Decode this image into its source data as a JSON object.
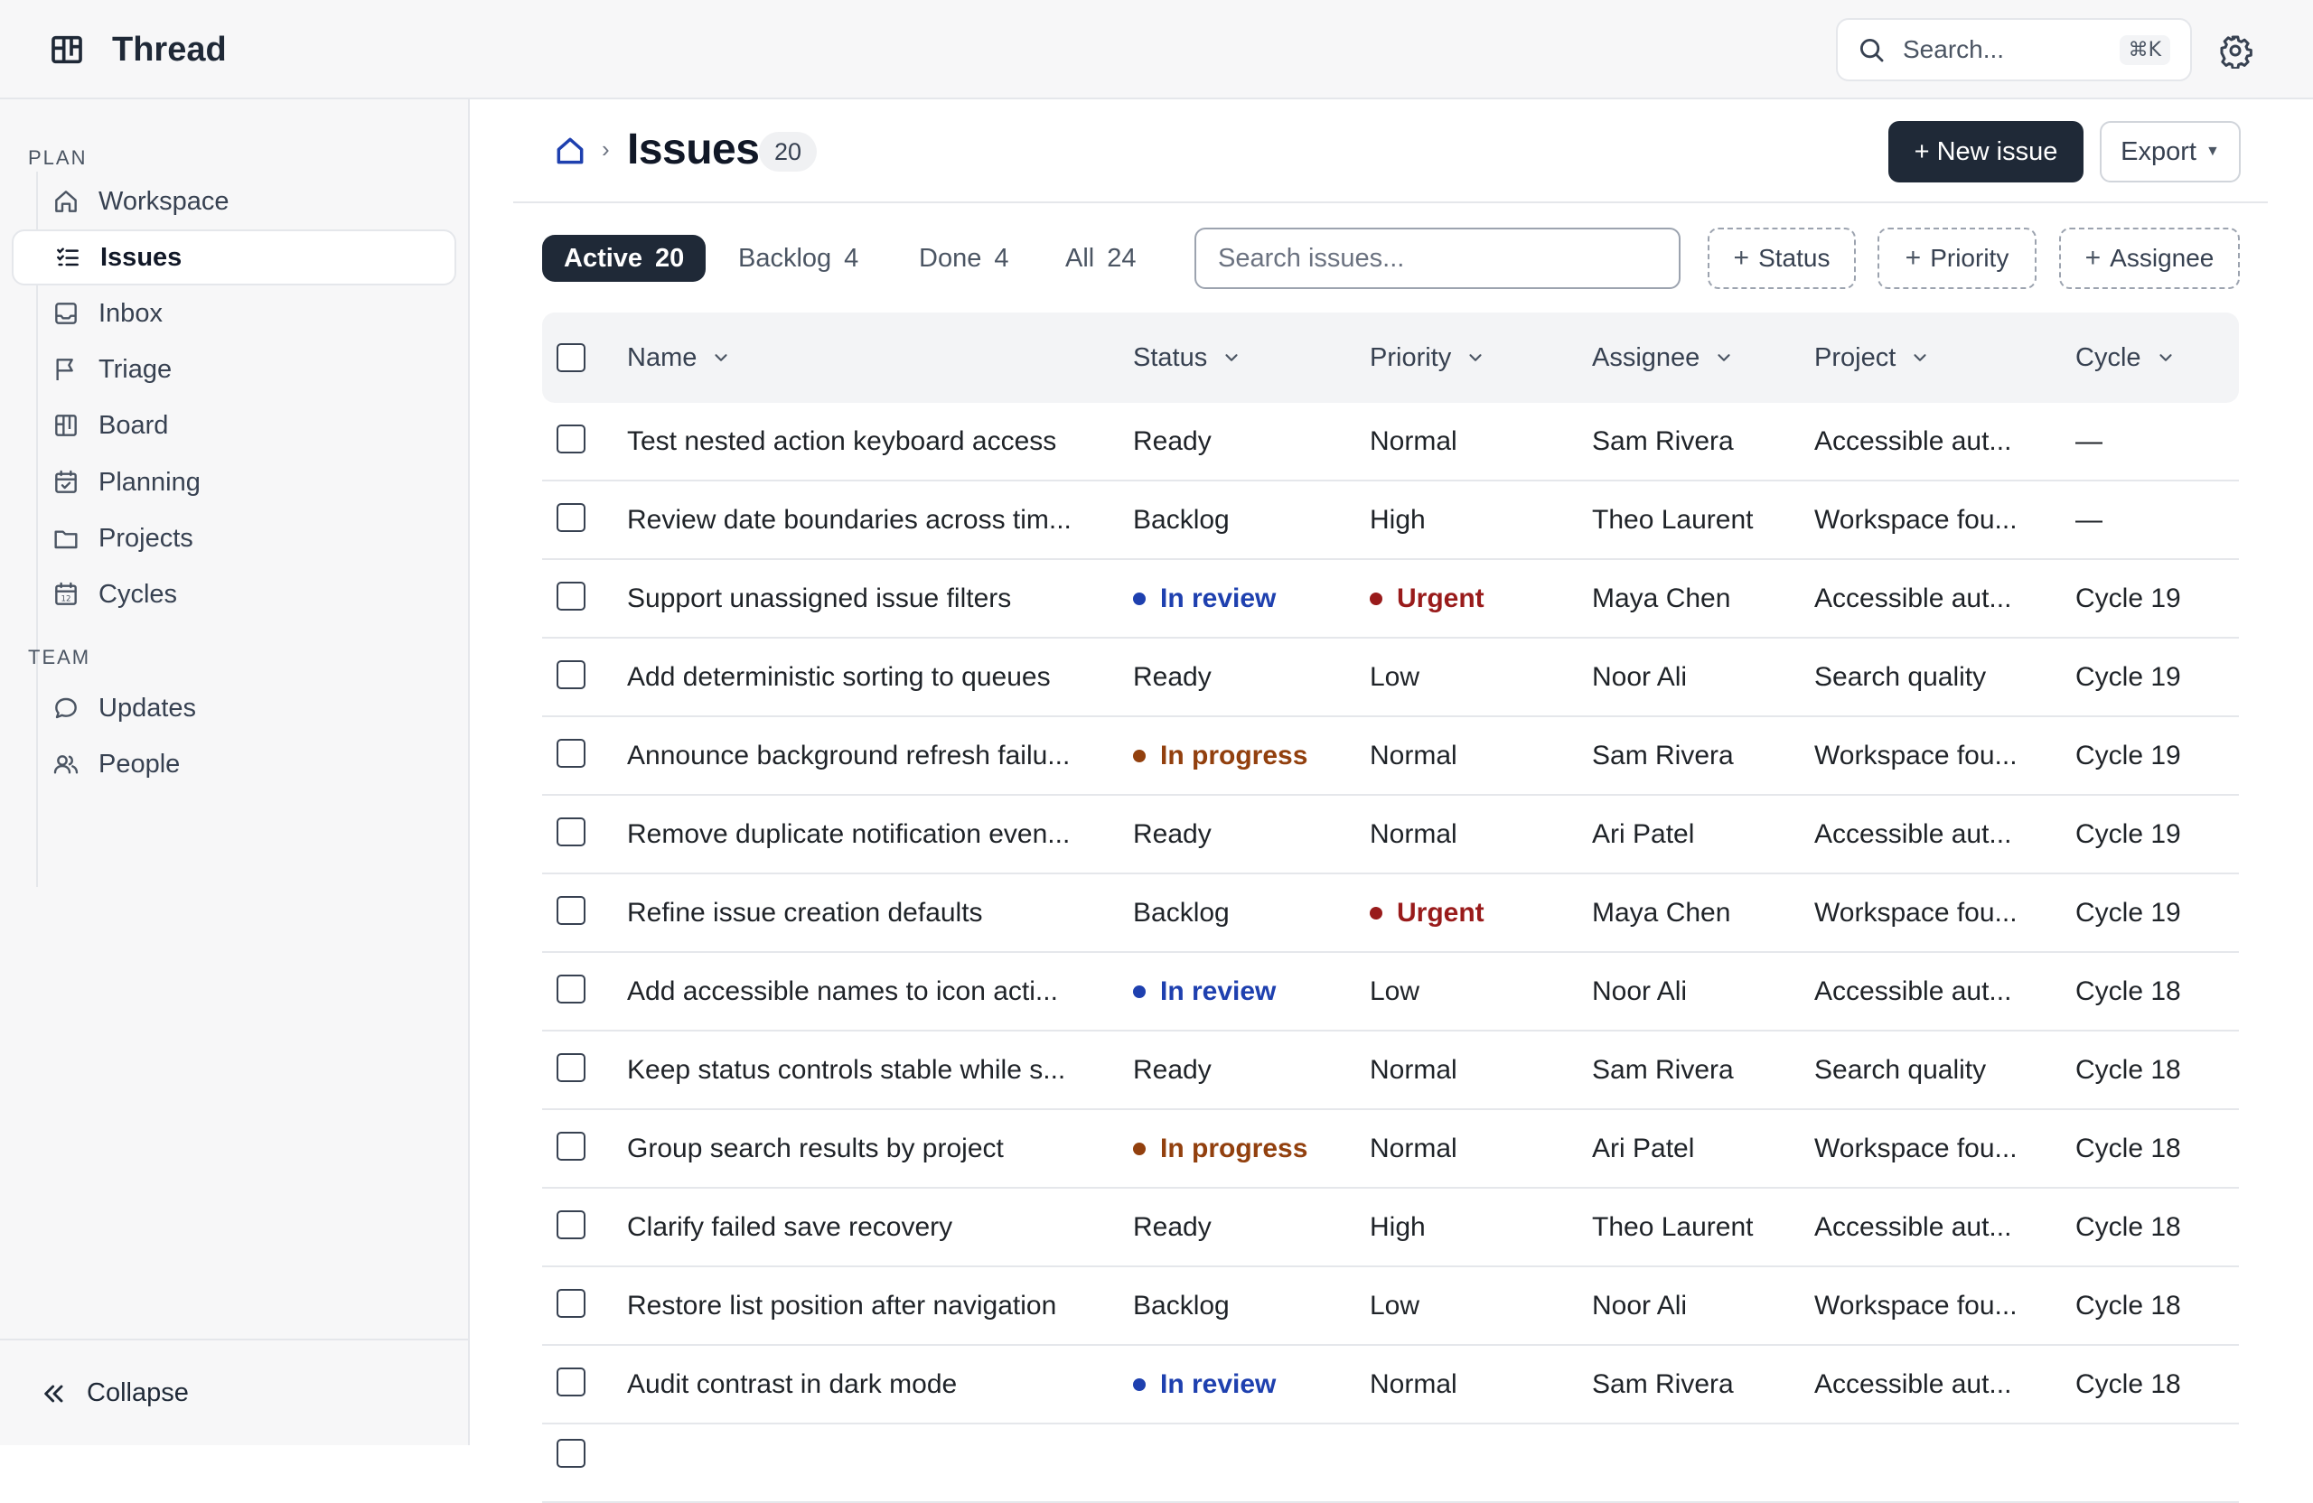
{
  "app": {
    "name": "Thread"
  },
  "topbar": {
    "search_placeholder": "Search...",
    "search_shortcut": "⌘K"
  },
  "sidebar": {
    "plan_label": "PLAN",
    "team_label": "TEAM",
    "plan_items": [
      {
        "label": "Workspace",
        "icon": "home-icon"
      },
      {
        "label": "Issues",
        "icon": "list-icon",
        "active": true
      },
      {
        "label": "Inbox",
        "icon": "inbox-icon"
      },
      {
        "label": "Triage",
        "icon": "flag-icon"
      },
      {
        "label": "Board",
        "icon": "board-icon"
      },
      {
        "label": "Planning",
        "icon": "calendar-check-icon"
      },
      {
        "label": "Projects",
        "icon": "folder-icon"
      },
      {
        "label": "Cycles",
        "icon": "calendar-icon"
      }
    ],
    "team_items": [
      {
        "label": "Updates",
        "icon": "chat-bubble-icon"
      },
      {
        "label": "People",
        "icon": "people-icon"
      }
    ],
    "collapse_label": "Collapse"
  },
  "header": {
    "title": "Issues",
    "count": "20",
    "new_issue_label": "+ New issue",
    "export_label": "Export"
  },
  "tabs": [
    {
      "label": "Active",
      "count": "20",
      "active": true
    },
    {
      "label": "Backlog",
      "count": "4"
    },
    {
      "label": "Done",
      "count": "4"
    },
    {
      "label": "All",
      "count": "24"
    }
  ],
  "filters": {
    "search_placeholder": "Search issues...",
    "chips": [
      "Status",
      "Priority",
      "Assignee"
    ]
  },
  "table": {
    "columns": [
      "Name",
      "Status",
      "Priority",
      "Assignee",
      "Project",
      "Cycle"
    ],
    "rows": [
      {
        "name": "Test nested action keyboard access",
        "status": "Ready",
        "priority": "Normal",
        "assignee": "Sam Rivera",
        "project": "Accessible aut...",
        "cycle": "—"
      },
      {
        "name": "Review date boundaries across tim...",
        "status": "Backlog",
        "priority": "High",
        "assignee": "Theo Laurent",
        "project": "Workspace fou...",
        "cycle": "—"
      },
      {
        "name": "Support unassigned issue filters",
        "status": "In review",
        "priority": "Urgent",
        "assignee": "Maya Chen",
        "project": "Accessible aut...",
        "cycle": "Cycle 19"
      },
      {
        "name": "Add deterministic sorting to queues",
        "status": "Ready",
        "priority": "Low",
        "assignee": "Noor Ali",
        "project": "Search quality",
        "cycle": "Cycle 19"
      },
      {
        "name": "Announce background refresh failu...",
        "status": "In progress",
        "priority": "Normal",
        "assignee": "Sam Rivera",
        "project": "Workspace fou...",
        "cycle": "Cycle 19"
      },
      {
        "name": "Remove duplicate notification even...",
        "status": "Ready",
        "priority": "Normal",
        "assignee": "Ari Patel",
        "project": "Accessible aut...",
        "cycle": "Cycle 19"
      },
      {
        "name": "Refine issue creation defaults",
        "status": "Backlog",
        "priority": "Urgent",
        "assignee": "Maya Chen",
        "project": "Workspace fou...",
        "cycle": "Cycle 19"
      },
      {
        "name": "Add accessible names to icon acti...",
        "status": "In review",
        "priority": "Low",
        "assignee": "Noor Ali",
        "project": "Accessible aut...",
        "cycle": "Cycle 18"
      },
      {
        "name": "Keep status controls stable while s...",
        "status": "Ready",
        "priority": "Normal",
        "assignee": "Sam Rivera",
        "project": "Search quality",
        "cycle": "Cycle 18"
      },
      {
        "name": "Group search results by project",
        "status": "In progress",
        "priority": "Normal",
        "assignee": "Ari Patel",
        "project": "Workspace fou...",
        "cycle": "Cycle 18"
      },
      {
        "name": "Clarify failed save recovery",
        "status": "Ready",
        "priority": "High",
        "assignee": "Theo Laurent",
        "project": "Accessible aut...",
        "cycle": "Cycle 18"
      },
      {
        "name": "Restore list position after navigation",
        "status": "Backlog",
        "priority": "Low",
        "assignee": "Noor Ali",
        "project": "Workspace fou...",
        "cycle": "Cycle 18"
      },
      {
        "name": "Audit contrast in dark mode",
        "status": "In review",
        "priority": "Normal",
        "assignee": "Sam Rivera",
        "project": "Accessible aut...",
        "cycle": "Cycle 18"
      }
    ]
  },
  "colors": {
    "in_review": "#1e40af",
    "in_progress": "#92400e",
    "urgent": "#991b1b",
    "primary_button": "#1f2937"
  }
}
